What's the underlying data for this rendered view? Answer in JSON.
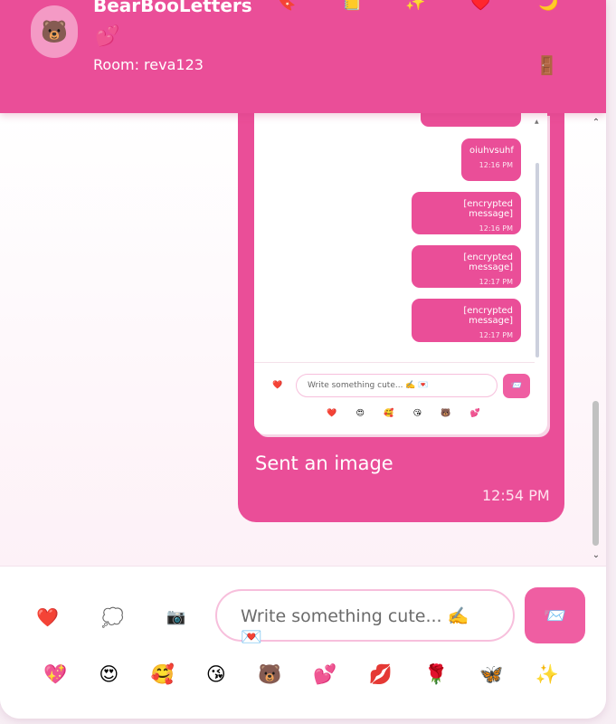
{
  "header": {
    "avatar": "🐻",
    "title": "BearBooLetters",
    "title_emoji": "💕",
    "room_label": "Room: reva123",
    "buttons": [
      "🔖",
      "📒",
      "✨",
      "♥️",
      "🌙"
    ],
    "exit_icon": "🚪"
  },
  "message": {
    "screenshot": {
      "bubbles": [
        {
          "text": "oiuhvsuhf",
          "time": "12:16 PM"
        },
        {
          "text": "[encrypted message]",
          "time": "12:16 PM"
        },
        {
          "text": "[encrypted message]",
          "time": "12:17 PM"
        },
        {
          "text": "[encrypted message]",
          "time": "12:17 PM"
        }
      ],
      "heart": "❤️",
      "input_placeholder": "Write something cute... ✍️ 💌",
      "send": "📨",
      "emojis": [
        "❤️",
        "😍",
        "🥰",
        "😘",
        "🐻",
        "💕"
      ]
    },
    "text": "Sent an image",
    "time": "12:54 PM"
  },
  "composer": {
    "heart": "❤️",
    "thought": "💭",
    "camera": "📷",
    "placeholder": "Write something cute... ✍️ 💌",
    "send": "📨",
    "emojis": [
      "💖",
      "😍",
      "🥰",
      "😘",
      "🐻",
      "💕",
      "💋",
      "🌹",
      "🦋",
      "✨"
    ]
  }
}
